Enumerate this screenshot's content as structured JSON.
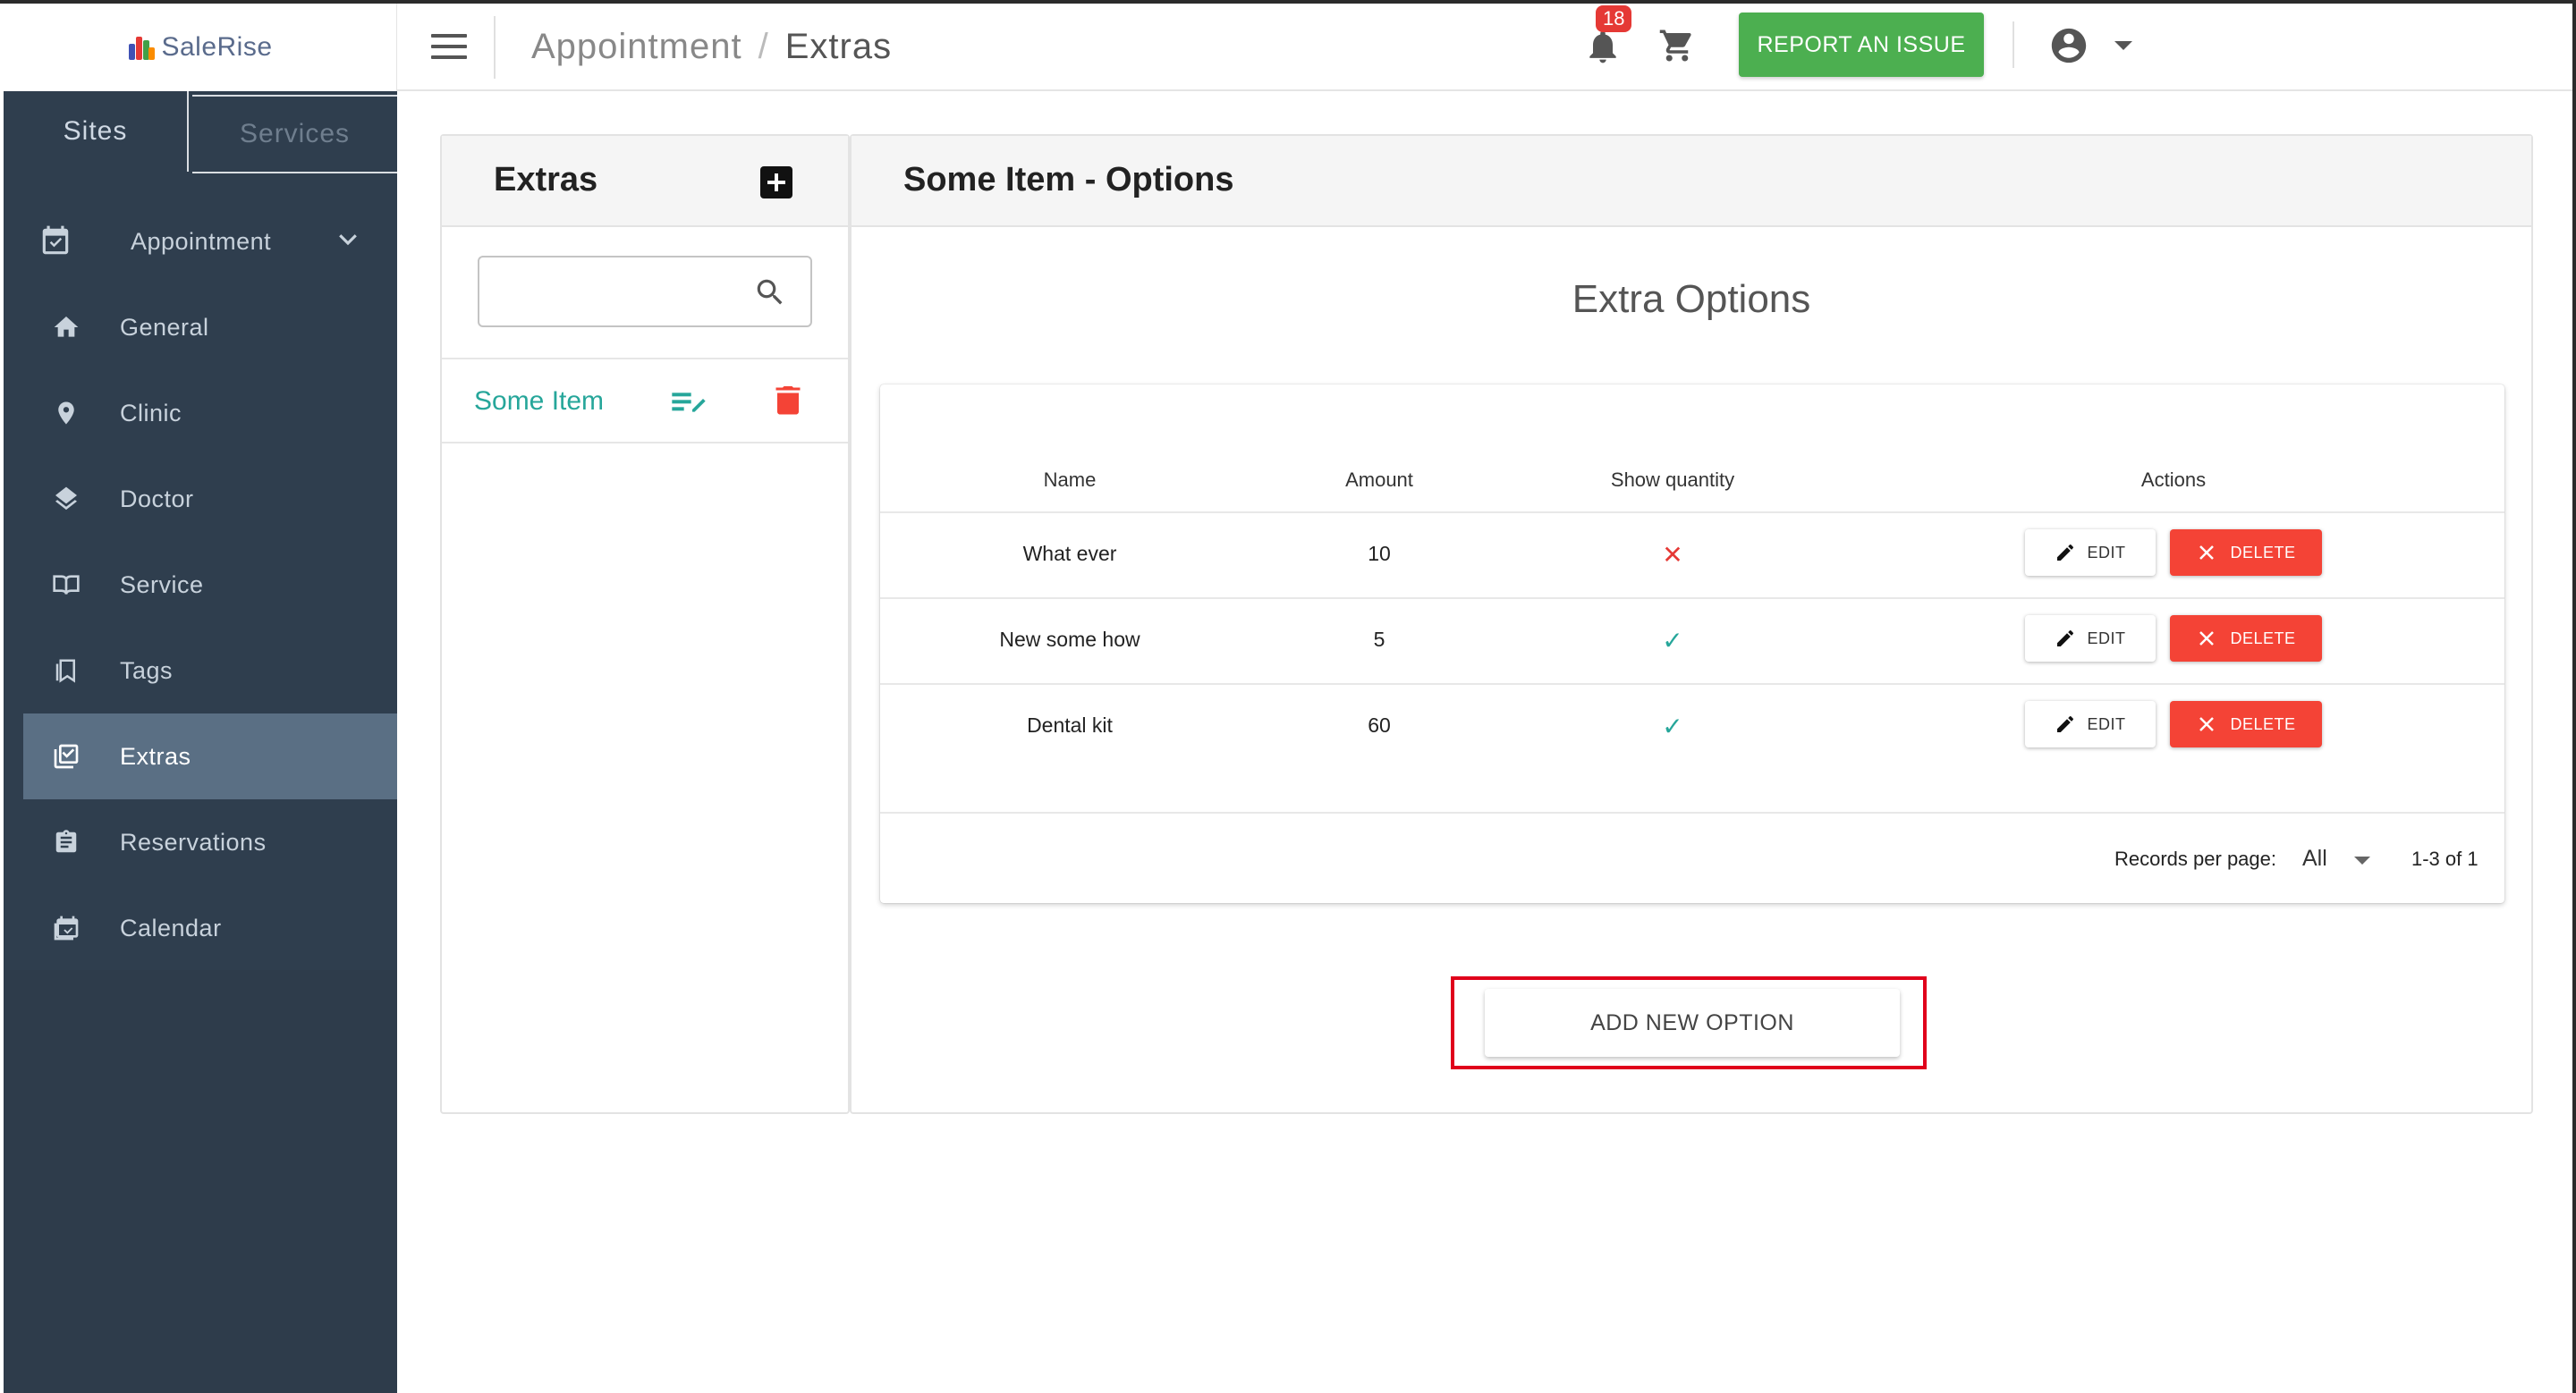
{
  "app": {
    "logo_text": "SaleRise"
  },
  "sidebar": {
    "tabs": [
      {
        "label": "Sites",
        "active": true
      },
      {
        "label": "Services",
        "active": false
      }
    ],
    "section": {
      "label": "Appointment",
      "icon": "calendar-check-icon"
    },
    "items": [
      {
        "label": "General",
        "icon": "home-icon"
      },
      {
        "label": "Clinic",
        "icon": "location-pin-icon"
      },
      {
        "label": "Doctor",
        "icon": "layers-icon"
      },
      {
        "label": "Service",
        "icon": "book-open-icon"
      },
      {
        "label": "Tags",
        "icon": "bookmark-icon"
      },
      {
        "label": "Extras",
        "icon": "library-check-icon",
        "active": true
      },
      {
        "label": "Reservations",
        "icon": "clipboard-list-icon"
      },
      {
        "label": "Calendar",
        "icon": "calendar-icon"
      }
    ]
  },
  "topbar": {
    "breadcrumb": [
      "Appointment",
      "Extras"
    ],
    "breadcrumb_sep": "/",
    "notifications_count": "18",
    "report_button": "REPORT AN ISSUE"
  },
  "extras_panel": {
    "title": "Extras",
    "search": {
      "value": "",
      "placeholder": ""
    },
    "items": [
      {
        "label": "Some Item"
      }
    ]
  },
  "options_panel": {
    "title": "Some Item - Options",
    "subtitle": "Extra Options",
    "table": {
      "columns": [
        "Name",
        "Amount",
        "Show quantity",
        "Actions"
      ],
      "rows": [
        {
          "name": "What ever",
          "amount": "10",
          "show_quantity": "✕",
          "show_quantity_bool": false
        },
        {
          "name": "New some how",
          "amount": "5",
          "show_quantity": "✓",
          "show_quantity_bool": true
        },
        {
          "name": "Dental kit",
          "amount": "60",
          "show_quantity": "✓",
          "show_quantity_bool": true
        }
      ],
      "edit_label": "EDIT",
      "delete_label": "DELETE",
      "records_per_page_label": "Records per page:",
      "records_per_page_value": "All",
      "pagination": "1-3 of 1"
    },
    "add_button": "ADD NEW OPTION"
  },
  "colors": {
    "sidebar_bg": "#2f3e4e",
    "sidebar_active": "#5a6f84",
    "accent_teal": "#26a69a",
    "report_green": "#4caf50",
    "delete_red": "#f44336",
    "highlight_red": "#e0001b"
  }
}
